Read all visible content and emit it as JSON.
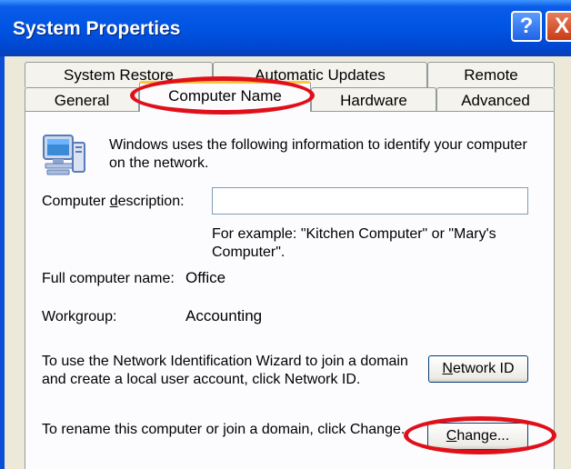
{
  "window": {
    "title": "System Properties",
    "help_glyph": "?",
    "close_glyph": "X"
  },
  "tabs": {
    "row1": [
      "System Restore",
      "Automatic Updates",
      "Remote"
    ],
    "row2": [
      "General",
      "Computer Name",
      "Hardware",
      "Advanced"
    ],
    "active": "Computer Name"
  },
  "computer_name": {
    "intro": "Windows uses the following information to identify your computer on the network.",
    "description_label_pre": "Computer ",
    "description_label_key": "d",
    "description_label_post": "escription:",
    "description_value": "",
    "example": "For example: \"Kitchen Computer\" or \"Mary's Computer\".",
    "full_name_label": "Full computer name:",
    "full_name_value": "Office",
    "workgroup_label": "Workgroup:",
    "workgroup_value": "Accounting",
    "network_id_text": "To use the Network Identification Wizard to join a domain and create a local user account, click Network ID.",
    "network_id_button_key": "N",
    "network_id_button_rest": "etwork ID",
    "rename_text": "To rename this computer or join a domain, click Change.",
    "change_button_key": "C",
    "change_button_rest": "hange..."
  },
  "colors": {
    "titlebar": "#0054e3",
    "dialog_bg": "#ECE9D8",
    "annotation_oval": "#e0101a",
    "active_tab_highlight": "#ffc83c"
  },
  "icons": [
    "computer-icon",
    "help-icon",
    "close-icon"
  ]
}
